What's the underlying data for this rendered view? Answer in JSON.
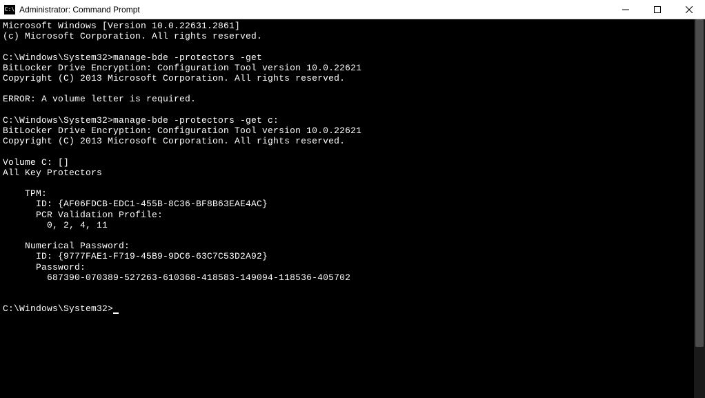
{
  "window": {
    "title": "Administrator: Command Prompt"
  },
  "terminal": {
    "lines": [
      "Microsoft Windows [Version 10.0.22631.2861]",
      "(c) Microsoft Corporation. All rights reserved.",
      "",
      "C:\\Windows\\System32>manage-bde -protectors -get",
      "BitLocker Drive Encryption: Configuration Tool version 10.0.22621",
      "Copyright (C) 2013 Microsoft Corporation. All rights reserved.",
      "",
      "ERROR: A volume letter is required.",
      "",
      "C:\\Windows\\System32>manage-bde -protectors -get c:",
      "BitLocker Drive Encryption: Configuration Tool version 10.0.22621",
      "Copyright (C) 2013 Microsoft Corporation. All rights reserved.",
      "",
      "Volume C: []",
      "All Key Protectors",
      "",
      "    TPM:",
      "      ID: {AF06FDCB-EDC1-455B-8C36-BF8B63EAE4AC}",
      "      PCR Validation Profile:",
      "        0, 2, 4, 11",
      "",
      "    Numerical Password:",
      "      ID: {9777FAE1-F719-45B9-9DC6-63C7C53D2A92}",
      "      Password:",
      "        687390-070389-527263-610368-418583-149094-118536-405702",
      "",
      "",
      "C:\\Windows\\System32>"
    ],
    "prompt": "C:\\Windows\\System32>"
  }
}
